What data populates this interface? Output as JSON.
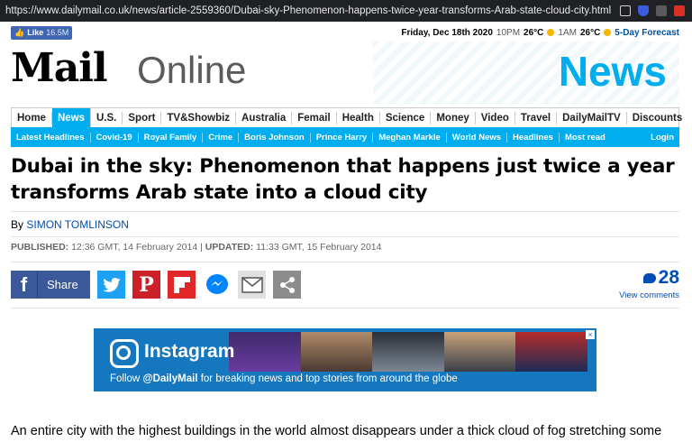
{
  "browser": {
    "url": "https://www.dailymail.co.uk/news/article-2559360/Dubai-sky-Phenomenon-happens-twice-year-transforms-Arab-state-cloud-city.html",
    "extension_icons": [
      "camera-icon",
      "shield-icon",
      "puzzle-icon",
      "record-icon"
    ]
  },
  "topstrip": {
    "like_label": "Like",
    "like_count": "16.5M",
    "date": "Friday, Dec 18th 2020",
    "time1": "10PM",
    "temp1": "26°C",
    "time2": "1AM",
    "temp2": "26°C",
    "forecast": "5-Day Forecast"
  },
  "masthead": {
    "logo_mail": "Mail",
    "logo_online": "Online",
    "section_title": "News"
  },
  "nav_primary": [
    "Home",
    "News",
    "U.S.",
    "Sport",
    "TV&Showbiz",
    "Australia",
    "Femail",
    "Health",
    "Science",
    "Money",
    "Video",
    "Travel",
    "DailyMailTV",
    "Discounts"
  ],
  "nav_primary_active": "News",
  "nav_secondary": [
    "Latest Headlines",
    "Covid-19",
    "Royal Family",
    "Crime",
    "Boris Johnson",
    "Prince Harry",
    "Meghan Markle",
    "World News",
    "Headlines",
    "Most read"
  ],
  "nav_login": "Login",
  "article": {
    "headline": "Dubai in the sky: Phenomenon that happens just twice a year transforms Arab state into a cloud city",
    "by_prefix": "By",
    "author": "SIMON TOMLINSON",
    "published_label": "PUBLISHED:",
    "published": "12:36 GMT, 14 February 2014",
    "separator": "|",
    "updated_label": "UPDATED:",
    "updated": "11:33 GMT, 15 February 2014",
    "body_start": "An entire city with the highest buildings in the world almost disappears under a thick cloud of fog stretching some"
  },
  "share": {
    "facebook_label": "Share",
    "comment_count": "28",
    "comments_label": "View comments"
  },
  "banner": {
    "brand": "Instagram",
    "tagline_prefix": "Follow",
    "handle": "@DailyMail",
    "tagline_rest": "for breaking news and top stories from around the globe",
    "close": "×"
  },
  "colors": {
    "accent": "#00aeef",
    "facebook": "#3b5998",
    "twitter": "#1da1f2",
    "pinterest": "#cb2027",
    "flipboard": "#e12828",
    "link": "#004db3",
    "instagram_banner": "#1577bd"
  }
}
